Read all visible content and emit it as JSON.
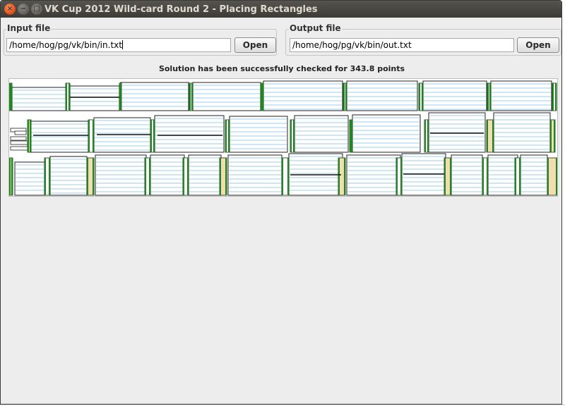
{
  "window": {
    "title": "VK Cup 2012 Wild-card Round 2 - Placing Rectangles"
  },
  "input": {
    "label": "Input file",
    "path": "/home/hog/pg/vk/bin/in.txt",
    "open_label": "Open"
  },
  "output": {
    "label": "Output file",
    "path": "/home/hog/pg/vk/bin/out.txt",
    "open_label": "Open"
  },
  "status": "Solution has been successfully checked for 343.8 points",
  "colors": {
    "stripe": "#cfe6f5",
    "green": "#1a8a1a",
    "peach": "#f5dbb0",
    "outline": "#202020"
  },
  "icons": [
    "close-icon",
    "minimize-icon",
    "maximize-icon"
  ]
}
